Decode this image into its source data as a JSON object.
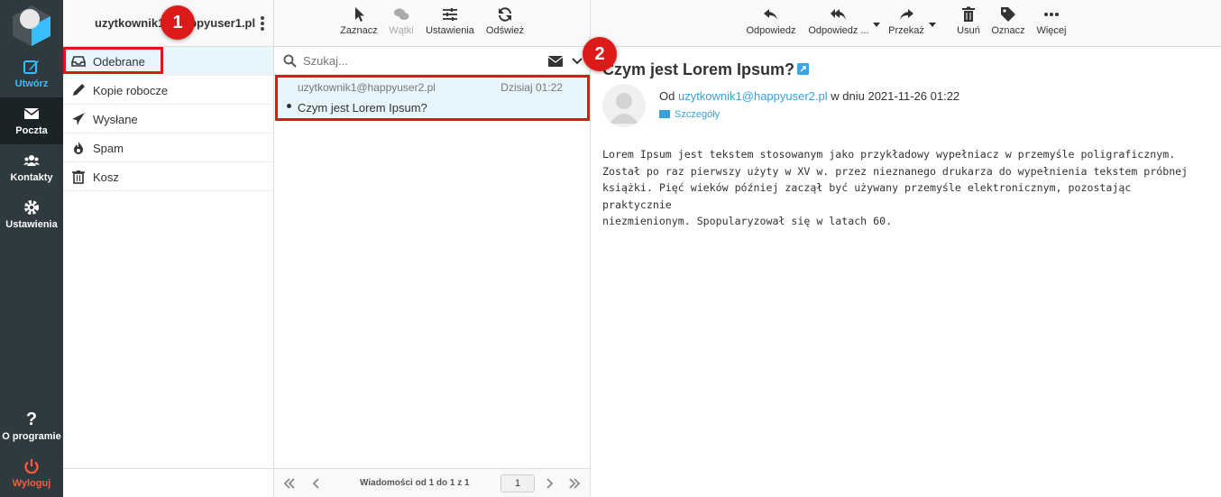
{
  "nav": {
    "items": [
      {
        "label": "Utwórz",
        "icon": "compose-icon"
      },
      {
        "label": "Poczta",
        "icon": "envelope-icon"
      },
      {
        "label": "Kontakty",
        "icon": "contacts-icon"
      },
      {
        "label": "Ustawienia",
        "icon": "gear-icon"
      }
    ],
    "about": "O programie",
    "logout": "Wyloguj"
  },
  "account": {
    "name": "uzytkownik1@happyuser1.pl"
  },
  "folders": [
    {
      "label": "Odebrane",
      "icon": "inbox-icon"
    },
    {
      "label": "Kopie robocze",
      "icon": "pencil-icon"
    },
    {
      "label": "Wysłane",
      "icon": "paper-plane-icon"
    },
    {
      "label": "Spam",
      "icon": "fire-icon"
    },
    {
      "label": "Kosz",
      "icon": "trash-icon"
    }
  ],
  "list_toolbar": {
    "select": "Zaznacz",
    "threads": "Wątki",
    "settings": "Ustawienia",
    "refresh": "Odśwież"
  },
  "search": {
    "placeholder": "Szukaj..."
  },
  "messages": [
    {
      "from": "uzytkownik1@happyuser2.pl",
      "date": "Dzisiaj 01:22",
      "subject": "Czym jest Lorem Ipsum?"
    }
  ],
  "list_footer": {
    "count": "Wiadomości od 1 do 1 z 1",
    "page": "1"
  },
  "reader_toolbar": {
    "reply": "Odpowiedz",
    "reply_all": "Odpowiedz ...",
    "forward": "Przekaż",
    "delete": "Usuń",
    "mark": "Oznacz",
    "more": "Więcej"
  },
  "reader": {
    "subject": "Czym jest Lorem Ipsum?",
    "from_prefix": "Od",
    "from_email": "uzytkownik1@happyuser2.pl",
    "date_text": "w dniu 2021-11-26 01:22",
    "details": "Szczegóły",
    "body_lines": [
      "Lorem Ipsum jest tekstem stosowanym jako przykładowy wypełniacz w przemyśle poligraficznym.",
      "Został po raz pierwszy użyty w XV w. przez nieznanego drukarza do wypełnienia tekstem próbnej",
      "książki. Pięć wieków później zaczął być używany przemyśle elektronicznym, pozostając praktycznie",
      "niezmienionym. Spopularyzował się w latach 60."
    ]
  },
  "annotations": {
    "badge1": "1",
    "badge2": "2"
  },
  "colors": {
    "accent": "#37beff",
    "highlight": "#e01616",
    "nav_bg": "#2f3a3f",
    "logout": "#ff5a3c"
  }
}
